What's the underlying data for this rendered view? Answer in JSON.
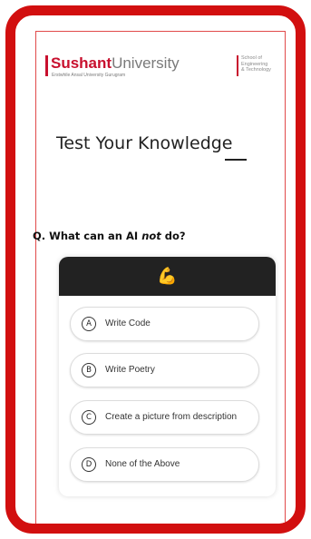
{
  "header": {
    "logo_bold": "Sushant",
    "logo_light": "University",
    "logo_sub": "Erstwhile Ansal University Gurugram",
    "school_line1": "School of",
    "school_line2": "Engineering",
    "school_line3": "& Technology"
  },
  "title": "Test Your Knowledge",
  "question": {
    "prefix": "Q. What can an AI ",
    "emphasis": "not",
    "suffix": " do?"
  },
  "quiz": {
    "header_icon": "muscle-emoji-icon",
    "header_glyph": "💪",
    "options": [
      {
        "letter": "A",
        "text": "Write Code"
      },
      {
        "letter": "B",
        "text": "Write Poetry"
      },
      {
        "letter": "C",
        "text": "Create a picture from description"
      },
      {
        "letter": "D",
        "text": "None of the Above"
      }
    ]
  },
  "colors": {
    "frame_red": "#d20f0f",
    "brand_red": "#c8102e",
    "dark_header": "#222222",
    "emoji_yellow": "#f2b705"
  }
}
